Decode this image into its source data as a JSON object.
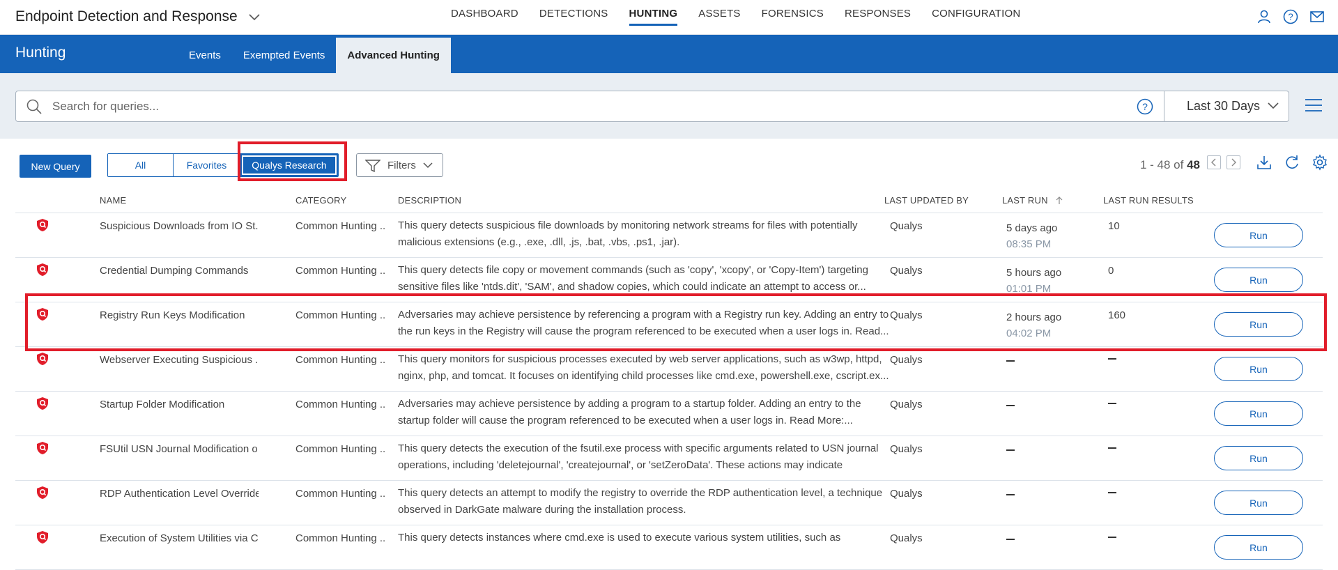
{
  "app": {
    "title": "Endpoint Detection and Response"
  },
  "topnav": [
    "DASHBOARD",
    "DETECTIONS",
    "HUNTING",
    "ASSETS",
    "FORENSICS",
    "RESPONSES",
    "CONFIGURATION"
  ],
  "topnav_active": "HUNTING",
  "section": {
    "title": "Hunting",
    "tabs": [
      "Events",
      "Exempted Events",
      "Advanced Hunting"
    ],
    "active_tab": "Advanced Hunting"
  },
  "search": {
    "placeholder": "Search for queries...",
    "range": "Last 30 Days"
  },
  "toolbar": {
    "new_query": "New Query",
    "segments": [
      "All",
      "Favorites",
      "Qualys Research"
    ],
    "active_segment": "Qualys Research",
    "filters": "Filters",
    "pager_range": "1 - 48 of",
    "pager_total": "48"
  },
  "columns": {
    "name": "NAME",
    "category": "CATEGORY",
    "description": "DESCRIPTION",
    "updated_by": "LAST UPDATED BY",
    "last_run": "LAST RUN",
    "results": "LAST RUN RESULTS"
  },
  "rows": [
    {
      "name": "Suspicious Downloads from IO St...",
      "category": "Common Hunting ...",
      "description": "This query detects suspicious file downloads by monitoring network streams for files with potentially malicious extensions (e.g., .exe, .dll, .js, .bat, .vbs, .ps1, .jar).",
      "updated_by": "Qualys",
      "run_ago": "5 days ago",
      "run_time": "08:35 PM",
      "results": "10",
      "run": "Run"
    },
    {
      "name": "Credential Dumping Commands",
      "category": "Common Hunting ...",
      "description": "This query detects file copy or movement commands (such as 'copy', 'xcopy', or 'Copy-Item') targeting sensitive files like 'ntds.dit', 'SAM', and shadow copies, which could indicate an attempt to access or...",
      "updated_by": "Qualys",
      "run_ago": "5 hours ago",
      "run_time": "01:01 PM",
      "results": "0",
      "run": "Run"
    },
    {
      "name": "Registry Run Keys Modification",
      "category": "Common Hunting ...",
      "description": "Adversaries may achieve persistence by referencing a program with a Registry run key. Adding an entry to the run keys in the Registry will cause the program referenced to be executed when a user logs in. Read...",
      "updated_by": "Qualys",
      "run_ago": "2 hours ago",
      "run_time": "04:02 PM",
      "results": "160",
      "run": "Run"
    },
    {
      "name": "Webserver Executing Suspicious ...",
      "category": "Common Hunting ...",
      "description": "This query monitors for suspicious processes executed by web server applications, such as w3wp, httpd, nginx, php, and tomcat. It focuses on identifying child processes like cmd.exe, powershell.exe, cscript.ex...",
      "updated_by": "Qualys",
      "run_ago": "",
      "run_time": "",
      "results": "",
      "run": "Run"
    },
    {
      "name": "Startup Folder Modification",
      "category": "Common Hunting ...",
      "description": "Adversaries may achieve persistence by adding a program to a startup folder. Adding an entry to the startup folder will cause the program referenced to be executed when a user logs in. Read More:...",
      "updated_by": "Qualys",
      "run_ago": "",
      "run_time": "",
      "results": "",
      "run": "Run"
    },
    {
      "name": "FSUtil USN Journal Modification o...",
      "category": "Common Hunting ...",
      "description": "This query detects the execution of the fsutil.exe process with specific arguments related to USN journal operations, including 'deletejournal', 'createjournal', or 'setZeroData'. These actions may indicate attempts...",
      "updated_by": "Qualys",
      "run_ago": "",
      "run_time": "",
      "results": "",
      "run": "Run"
    },
    {
      "name": "RDP Authentication Level Override",
      "category": "Common Hunting ...",
      "description": "This query detects an attempt to modify the registry to override the RDP authentication level, a technique observed in DarkGate malware during the installation process.",
      "updated_by": "Qualys",
      "run_ago": "",
      "run_time": "",
      "results": "",
      "run": "Run"
    },
    {
      "name": "Execution of System Utilities via C...",
      "category": "Common Hunting ...",
      "description": "This query detects instances where cmd.exe is used to execute various system utilities, such as",
      "updated_by": "Qualys",
      "run_ago": "",
      "run_time": "",
      "results": "",
      "run": "Run"
    }
  ],
  "colors": {
    "brand": "#1563b8",
    "highlight": "#e11d2a",
    "shield": "#e11d2a"
  }
}
